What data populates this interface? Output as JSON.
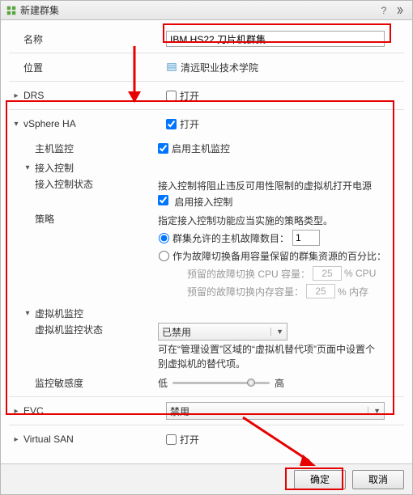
{
  "titlebar": {
    "icon_color": "#59a63f",
    "title": "新建群集"
  },
  "fields": {
    "name_label": "名称",
    "name_value": "IBM HS22 刀片机群集",
    "location_label": "位置",
    "location_value": "清远职业技术学院",
    "drs_label": "DRS",
    "drs_open": "打开",
    "ha_label": "vSphere HA",
    "ha_open": "打开",
    "host_mon_label": "主机监控",
    "host_mon_enable": "启用主机监控",
    "admission_head": "接入控制",
    "admission_state_label": "接入控制状态",
    "admission_desc": "接入控制将阻止违反可用性限制的虚拟机打开电源",
    "admission_enable": "启用接入控制",
    "policy_label": "策略",
    "policy_desc": "指定接入控制功能应当实施的策略类型。",
    "policy_radio1": "群集允许的主机故障数目：",
    "policy_radio1_val": "1",
    "policy_radio2": "作为故障切换备用容量保留的群集资源的百分比：",
    "reserve_cpu_label": "预留的故障切换 CPU 容量：",
    "reserve_cpu_val": "25",
    "reserve_cpu_unit": "%  CPU",
    "reserve_mem_label": "预留的故障切换内存容量：",
    "reserve_mem_val": "25",
    "reserve_mem_unit": "%  内存",
    "vm_mon_head": "虚拟机监控",
    "vm_mon_state_label": "虚拟机监控状态",
    "vm_mon_state_value": "已禁用",
    "vm_mon_desc": "可在“管理设置”区域的“虚拟机替代项”页面中设置个别虚拟机的替代项。",
    "sensitivity_label": "监控敏感度",
    "sensitivity_low": "低",
    "sensitivity_high": "高",
    "evc_label": "EVC",
    "evc_value": "禁用",
    "vsan_label": "Virtual SAN",
    "vsan_open": "打开"
  },
  "footer": {
    "ok": "确定",
    "cancel": "取消"
  }
}
